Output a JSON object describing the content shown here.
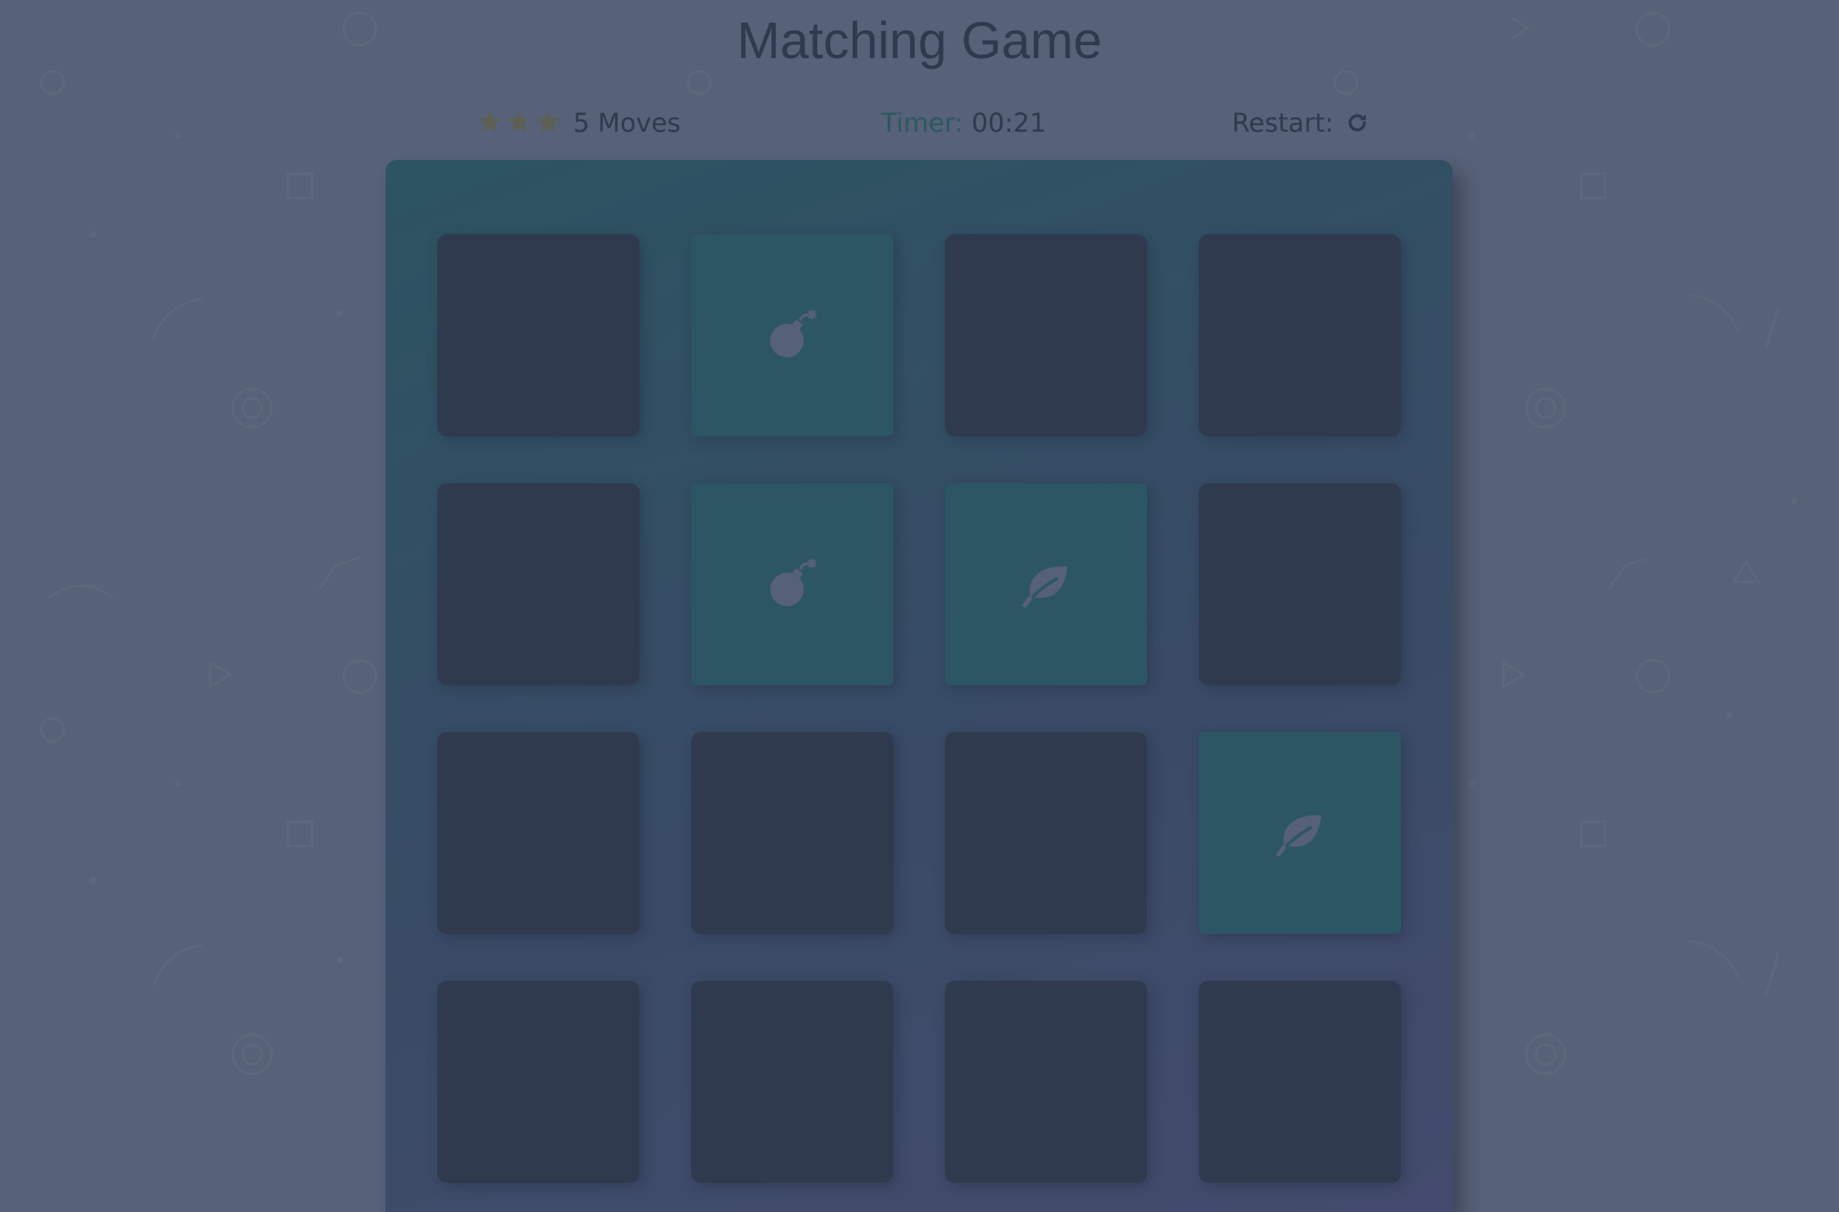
{
  "title": "Matching Game",
  "score_panel": {
    "stars": [
      {
        "icon": "star-icon"
      },
      {
        "icon": "star-icon"
      },
      {
        "icon": "star-icon"
      }
    ],
    "moves_text": "5 Moves",
    "timer_label": "Timer:",
    "timer_value": "00:21",
    "restart_label": "Restart:",
    "restart_icon": "restart-icon"
  },
  "deck": {
    "cards": [
      {
        "state": "closed",
        "icon": ""
      },
      {
        "state": "open",
        "icon": "bomb-icon"
      },
      {
        "state": "closed",
        "icon": ""
      },
      {
        "state": "closed",
        "icon": ""
      },
      {
        "state": "closed",
        "icon": ""
      },
      {
        "state": "open",
        "icon": "bomb-icon"
      },
      {
        "state": "open",
        "icon": "leaf-icon"
      },
      {
        "state": "closed",
        "icon": ""
      },
      {
        "state": "closed",
        "icon": ""
      },
      {
        "state": "closed",
        "icon": ""
      },
      {
        "state": "closed",
        "icon": ""
      },
      {
        "state": "open",
        "icon": "leaf-icon"
      },
      {
        "state": "closed",
        "icon": ""
      },
      {
        "state": "closed",
        "icon": ""
      },
      {
        "state": "closed",
        "icon": ""
      },
      {
        "state": "closed",
        "icon": ""
      }
    ]
  },
  "colors": {
    "background": "#576177",
    "card_closed": "#2f3a4f",
    "card_open": "#2c5664",
    "star": "#5d5f52",
    "timer_label": "#2b5962"
  }
}
